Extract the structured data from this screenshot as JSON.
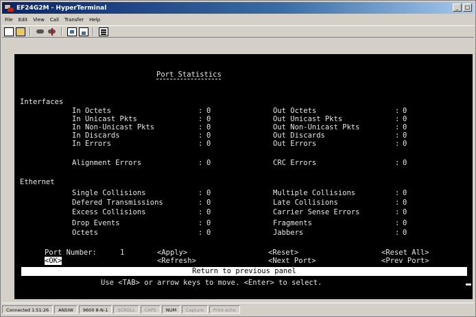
{
  "window": {
    "title": "EF24G2M - HyperTerminal",
    "minimize": "_",
    "maximize": "□"
  },
  "menu": [
    "File",
    "Edit",
    "View",
    "Call",
    "Transfer",
    "Help"
  ],
  "toolbar": [
    "new-icon",
    "open-icon",
    "connect-icon",
    "disconnect-icon",
    "send-icon",
    "receive-icon",
    "properties-icon"
  ],
  "terminal": {
    "title": "Port Statistics",
    "sections": {
      "interfaces": "Interfaces",
      "ethernet": "Ethernet"
    },
    "interfaces_left": [
      {
        "label": "In Octets",
        "value": "0"
      },
      {
        "label": "In Unicast Pkts",
        "value": "0"
      },
      {
        "label": "In Non-Unicast Pkts",
        "value": "0"
      },
      {
        "label": "In Discards",
        "value": "0"
      },
      {
        "label": "In Errors",
        "value": "0"
      },
      {
        "label": "Alignment Errors",
        "value": "0"
      }
    ],
    "interfaces_right": [
      {
        "label": "Out Octets",
        "value": "0"
      },
      {
        "label": "Out Unicast Pkts",
        "value": "0"
      },
      {
        "label": "Out Non-Unicast Pkts",
        "value": "0"
      },
      {
        "label": "Out Discards",
        "value": "0"
      },
      {
        "label": "Out Errors",
        "value": "0"
      },
      {
        "label": "CRC Errors",
        "value": "0"
      }
    ],
    "ethernet_left": [
      {
        "label": "Single Collisions",
        "value": "0"
      },
      {
        "label": "Defered Transmissions",
        "value": "0"
      },
      {
        "label": "Excess Collisions",
        "value": "0"
      },
      {
        "label": "Drop Events",
        "value": "0"
      },
      {
        "label": "Octets",
        "value": "0"
      }
    ],
    "ethernet_right": [
      {
        "label": "Multiple Collisions",
        "value": "0"
      },
      {
        "label": "Late Collisions",
        "value": "0"
      },
      {
        "label": "Carrier Sense Errors",
        "value": "0"
      },
      {
        "label": "Fragments",
        "value": "0"
      },
      {
        "label": "Jabbers",
        "value": "0"
      }
    ],
    "port_label": "Port Number:",
    "port_value": "1",
    "buttons": {
      "ok": "<OK>",
      "apply": "<Apply>",
      "refresh": "<Refresh>",
      "reset": "<Reset>",
      "next_port": "<Next Port>",
      "reset_all": "<Reset All>",
      "prev_port": "<Prev Port>"
    },
    "selected_help": "Return to previous panel",
    "help_text": "Use <TAB> or arrow keys to move. <Enter> to select."
  },
  "status": [
    "Connected 1:51:26",
    "ANSIW",
    "9600 8-N-1",
    "SCROLL",
    "CAPS",
    "NUM",
    "Capture",
    "Print echo"
  ]
}
